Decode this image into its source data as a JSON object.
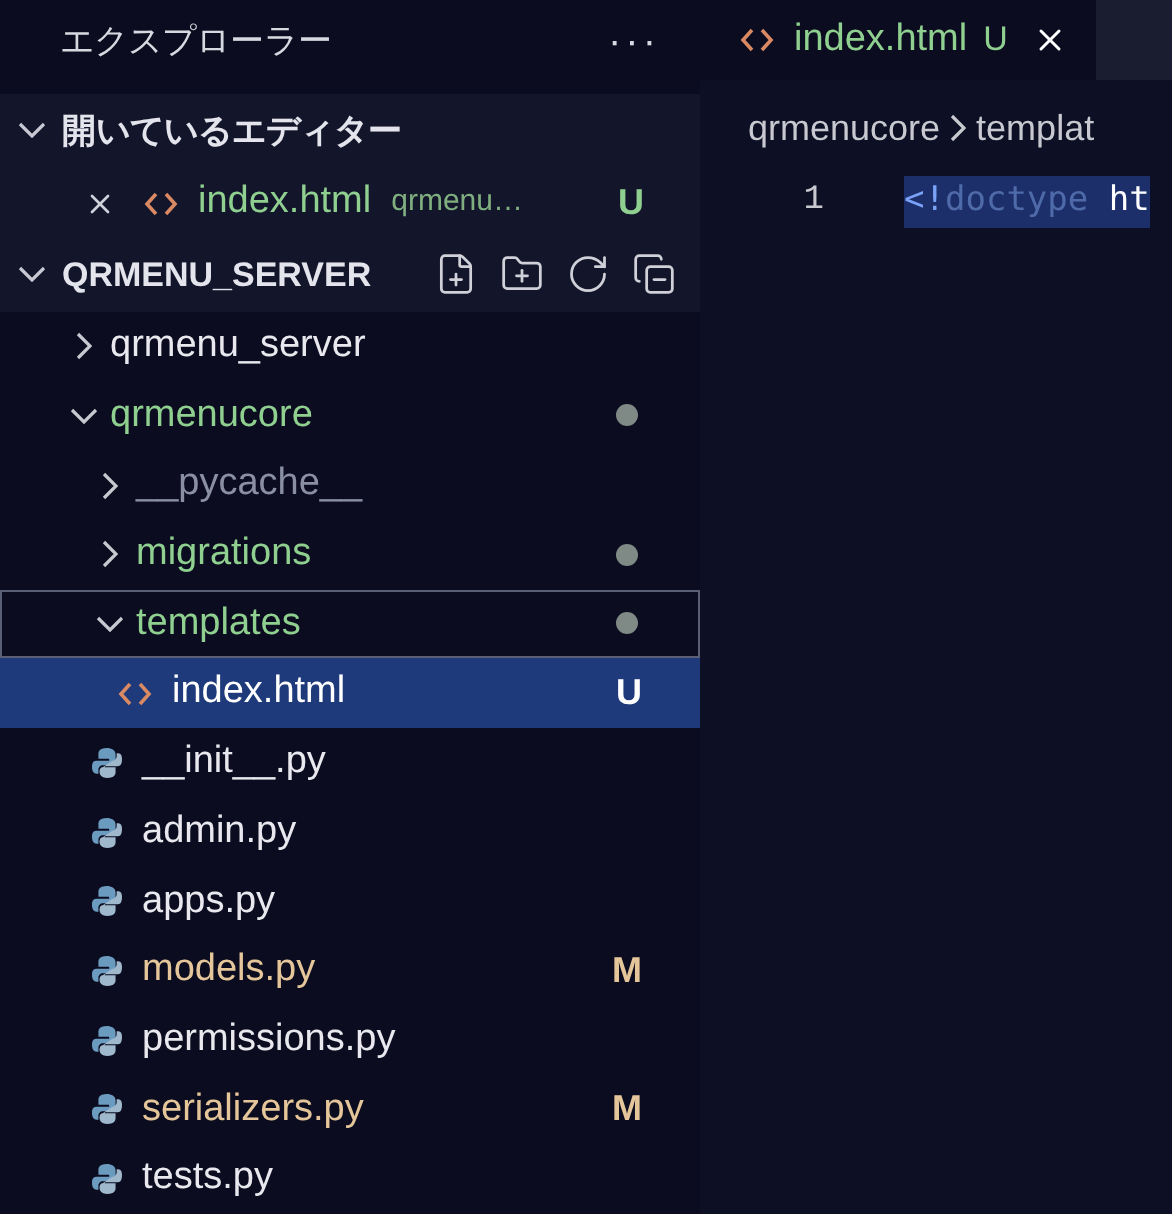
{
  "sidebar": {
    "title": "エクスプローラー",
    "more": "···",
    "open_editors": {
      "title": "開いているエディター",
      "expanded": true,
      "items": [
        {
          "name": "index.html",
          "path": "qrmenu…",
          "badge": "U",
          "color": "#8fcf8f"
        }
      ]
    },
    "workspace": {
      "title": "QRMENU_SERVER",
      "expanded": true,
      "tree": [
        {
          "name": "qrmenu_server",
          "kind": "folder",
          "expanded": false,
          "color": "#e8e8ee",
          "selected": false
        },
        {
          "name": "qrmenucore",
          "kind": "folder",
          "expanded": true,
          "color": "#8fcf8f",
          "dot": true,
          "selected": false,
          "children": [
            {
              "name": "__pycache__",
              "kind": "folder",
              "expanded": false,
              "color": "#8a8fa3",
              "selected": false
            },
            {
              "name": "migrations",
              "kind": "folder",
              "expanded": false,
              "color": "#8fcf8f",
              "dot": true,
              "selected": false
            },
            {
              "name": "templates",
              "kind": "folder",
              "expanded": true,
              "color": "#8fcf8f",
              "dot": true,
              "selected": false,
              "focused": true,
              "children": [
                {
                  "name": "index.html",
                  "kind": "html",
                  "color": "#ffffff",
                  "badge": "U",
                  "selected": true
                }
              ]
            },
            {
              "name": "__init__.py",
              "kind": "python",
              "color": "#e8e8ee",
              "selected": false
            },
            {
              "name": "admin.py",
              "kind": "python",
              "color": "#e8e8ee",
              "selected": false
            },
            {
              "name": "apps.py",
              "kind": "python",
              "color": "#e8e8ee",
              "selected": false
            },
            {
              "name": "models.py",
              "kind": "python",
              "color": "#e4c69a",
              "badge": "M",
              "selected": false
            },
            {
              "name": "permissions.py",
              "kind": "python",
              "color": "#e8e8ee",
              "selected": false
            },
            {
              "name": "serializers.py",
              "kind": "python",
              "color": "#e4c69a",
              "badge": "M",
              "selected": false
            },
            {
              "name": "tests.py",
              "kind": "python",
              "color": "#e8e8ee",
              "selected": false
            }
          ]
        }
      ]
    }
  },
  "editor": {
    "tabs": [
      {
        "name": "index.html",
        "badge": "U",
        "color": "#8fcf8f",
        "selected": true
      }
    ],
    "breadcrumb": [
      "qrmenucore",
      "templat"
    ],
    "lines": [
      {
        "number": "1",
        "tokens": [
          {
            "text": "<!",
            "kind": "punct"
          },
          {
            "text": "doctype",
            "kind": "keyword"
          },
          {
            "text": " ht",
            "kind": "plain"
          }
        ]
      }
    ]
  }
}
